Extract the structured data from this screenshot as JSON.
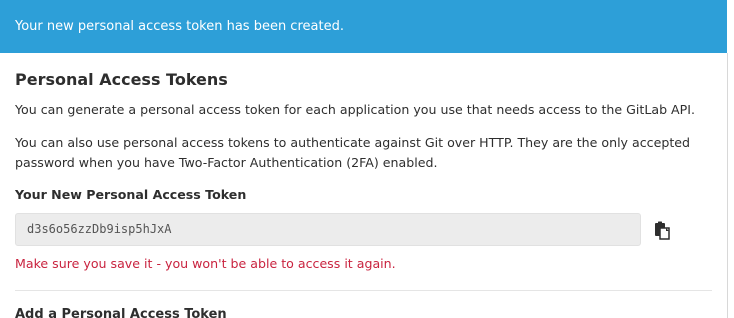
{
  "flash": {
    "message": "Your new personal access token has been created."
  },
  "section": {
    "title": "Personal Access Tokens",
    "description_1": "You can generate a personal access token for each application you use that needs access to the GitLab API.",
    "description_2": "You can also use personal access tokens to authenticate against Git over HTTP. They are the only accepted password when you have Two-Factor Authentication (2FA) enabled."
  },
  "new_token": {
    "label": "Your New Personal Access Token",
    "value": "d3s6o56zzDb9isp5hJxA",
    "copy_icon": "clipboard-icon",
    "warning": "Make sure you save it - you won't be able to access it again."
  },
  "add_token": {
    "title": "Add a Personal Access Token"
  },
  "colors": {
    "flash_background": "#2d9fd8",
    "warning_text": "#c9233f",
    "token_field_background": "#ececec"
  }
}
